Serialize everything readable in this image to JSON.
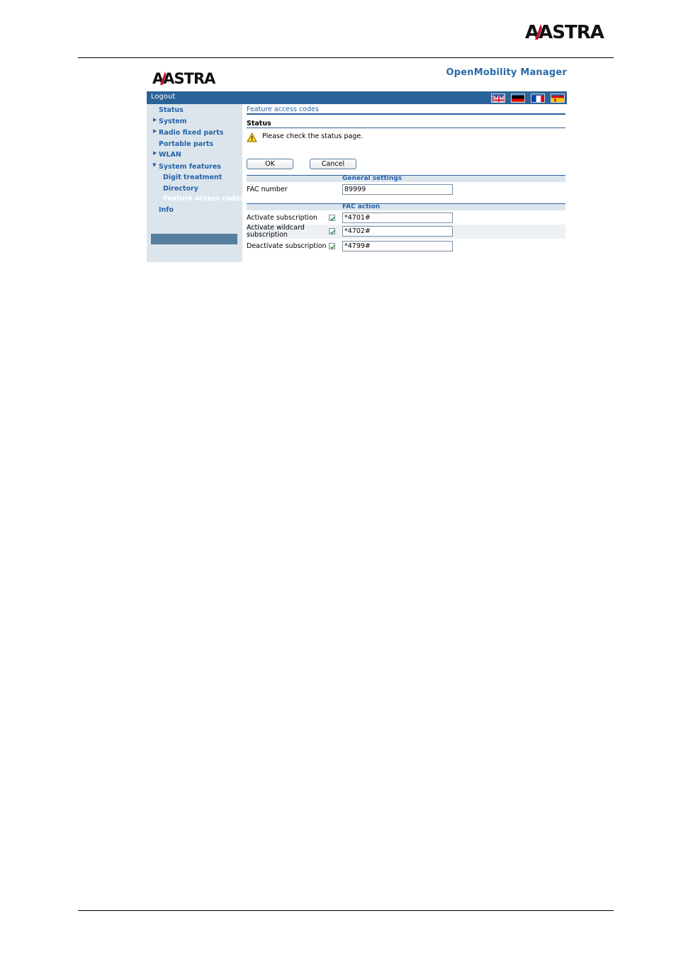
{
  "doc": {
    "logo_text": "AASTRA"
  },
  "app": {
    "logo_text": "AASTRA",
    "title": "OpenMobility Manager",
    "logout_label": "Logout",
    "languages": [
      "english-flag-icon",
      "german-flag-icon",
      "french-flag-icon",
      "spanish-flag-icon"
    ]
  },
  "sidebar": {
    "items": [
      {
        "label": "Status"
      },
      {
        "label": "System"
      },
      {
        "label": "Radio fixed parts"
      },
      {
        "label": "Portable parts"
      },
      {
        "label": "WLAN"
      },
      {
        "label": "System features"
      },
      {
        "label": "Digit treatment"
      },
      {
        "label": "Directory"
      },
      {
        "label": "Feature access codes"
      },
      {
        "label": "Info"
      }
    ]
  },
  "main": {
    "breadcrumb": "Feature access codes",
    "status_title": "Status",
    "status_message": "Please check the status page.",
    "ok_label": "OK",
    "cancel_label": "Cancel",
    "general_settings_title": "General settings",
    "fac_number_label": "FAC number",
    "fac_number_value": "89999",
    "fac_action_title": "FAC action",
    "actions": [
      {
        "label": "Activate subscription",
        "checked": true,
        "value": "*4701#"
      },
      {
        "label_line1": "Activate wildcard",
        "label_line2": "subscription",
        "checked": true,
        "value": "*4702#"
      },
      {
        "label": "Deactivate subscription",
        "checked": true,
        "value": "*4799#"
      }
    ]
  },
  "colors": {
    "accent": "#2a6399",
    "link": "#2563a8",
    "sidebar": "#dce5ec",
    "active": "#567f9f"
  }
}
